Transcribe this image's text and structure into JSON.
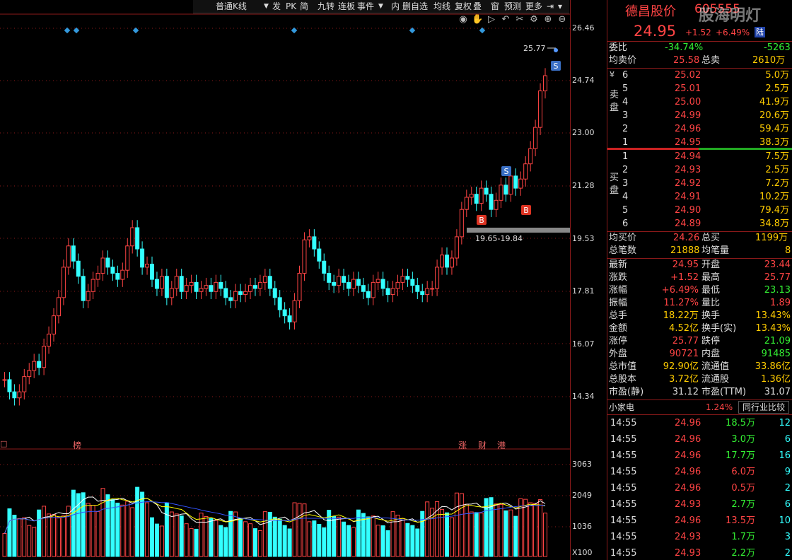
{
  "toolbar": {
    "items": [
      "普通K线",
      "发",
      "PK",
      "简",
      "九转",
      "连板",
      "事件",
      "内",
      "删自选",
      "均线",
      "复权",
      "叠",
      "窗",
      "预测",
      "更多"
    ],
    "dropdown_arrow": "▼",
    "pin_icon": "pin-icon"
  },
  "stock": {
    "name": "德昌股价",
    "code": "605555",
    "price": "24.95",
    "change": "+1.52",
    "change_pct": "+6.49%",
    "badge": "陆",
    "watermark": "股海明灯"
  },
  "chart": {
    "price_axis": [
      "26.46",
      "24.74",
      "23.00",
      "21.28",
      "19.53",
      "17.81",
      "16.07",
      "14.34"
    ],
    "vol_axis": [
      "3063",
      "2049",
      "1036",
      "X100"
    ],
    "high_marker": "25.77",
    "range_label": "19.65-19.84",
    "markers": [
      "S",
      "S",
      "B",
      "B"
    ],
    "event_tags": [
      "榜",
      "涨",
      "财",
      "港",
      "□"
    ],
    "colors": {
      "up": "#ff4444",
      "down": "#33ffff",
      "ma5": "#ffffff",
      "ma10": "#ffff00",
      "ma20": "#3355ff",
      "grid": "#8b1a1a"
    }
  },
  "quote": {
    "ratio_label": "委比",
    "ratio_pct": "-34.74%",
    "ratio_diff": "-5263",
    "avg_sell_label": "均卖价",
    "avg_sell": "25.58",
    "total_sell_label": "总卖",
    "total_sell": "2610万",
    "sell_side": "卖盘",
    "sell_marker": "¥",
    "sells": [
      {
        "lvl": "6",
        "price": "25.02",
        "vol": "5.0万"
      },
      {
        "lvl": "5",
        "price": "25.01",
        "vol": "2.5万"
      },
      {
        "lvl": "4",
        "price": "25.00",
        "vol": "41.9万"
      },
      {
        "lvl": "3",
        "price": "24.99",
        "vol": "20.6万"
      },
      {
        "lvl": "2",
        "price": "24.96",
        "vol": "59.4万"
      },
      {
        "lvl": "1",
        "price": "24.95",
        "vol": "38.3万"
      }
    ],
    "buy_side": "买盘",
    "buys": [
      {
        "lvl": "1",
        "price": "24.94",
        "vol": "7.5万"
      },
      {
        "lvl": "2",
        "price": "24.93",
        "vol": "2.5万"
      },
      {
        "lvl": "3",
        "price": "24.92",
        "vol": "7.2万"
      },
      {
        "lvl": "4",
        "price": "24.91",
        "vol": "10.2万"
      },
      {
        "lvl": "5",
        "price": "24.90",
        "vol": "79.4万"
      },
      {
        "lvl": "6",
        "price": "24.89",
        "vol": "34.8万"
      }
    ],
    "avg_buy_label": "均买价",
    "avg_buy": "24.26",
    "total_buy_label": "总买",
    "total_buy": "1199万",
    "total_trades_label": "总笔数",
    "total_trades": "21888",
    "avg_trade_label": "均笔量",
    "avg_trade": "8"
  },
  "stats": [
    {
      "l1": "最新",
      "v1": "24.95",
      "c1": "red",
      "l2": "开盘",
      "v2": "23.44",
      "c2": "red"
    },
    {
      "l1": "涨跌",
      "v1": "+1.52",
      "c1": "red",
      "l2": "最高",
      "v2": "25.77",
      "c2": "red"
    },
    {
      "l1": "涨幅",
      "v1": "+6.49%",
      "c1": "red",
      "l2": "最低",
      "v2": "23.13",
      "c2": "green"
    },
    {
      "l1": "振幅",
      "v1": "11.27%",
      "c1": "red",
      "l2": "量比",
      "v2": "1.89",
      "c2": "red"
    },
    {
      "l1": "总手",
      "v1": "18.22万",
      "c1": "yellow",
      "l2": "换手",
      "v2": "13.43%",
      "c2": "yellow"
    },
    {
      "l1": "金额",
      "v1": "4.52亿",
      "c1": "yellow",
      "l2": "换手(实)",
      "v2": "13.43%",
      "c2": "yellow"
    },
    {
      "l1": "涨停",
      "v1": "25.77",
      "c1": "red",
      "l2": "跌停",
      "v2": "21.09",
      "c2": "green"
    },
    {
      "l1": "外盘",
      "v1": "90721",
      "c1": "red",
      "l2": "内盘",
      "v2": "91485",
      "c2": "green"
    },
    {
      "l1": "总市值",
      "v1": "92.90亿",
      "c1": "yellow",
      "l2": "流通值",
      "v2": "33.86亿",
      "c2": "yellow"
    },
    {
      "l1": "总股本",
      "v1": "3.72亿",
      "c1": "yellow",
      "l2": "流通股",
      "v2": "1.36亿",
      "c2": "yellow"
    },
    {
      "l1": "市盈(静)",
      "v1": "31.12",
      "c1": "white",
      "l2": "市盈(TTM)",
      "v2": "31.07",
      "c2": "white"
    }
  ],
  "small_trades": {
    "label": "小家电",
    "pct": "1.24%",
    "compare": "同行业比较"
  },
  "ticks": [
    {
      "t": "14:55",
      "p": "24.96",
      "v": "18.5万",
      "n": "12",
      "vc": "green"
    },
    {
      "t": "14:55",
      "p": "24.96",
      "v": "3.0万",
      "n": "6",
      "vc": "green"
    },
    {
      "t": "14:55",
      "p": "24.96",
      "v": "17.7万",
      "n": "16",
      "vc": "green"
    },
    {
      "t": "14:55",
      "p": "24.96",
      "v": "6.0万",
      "n": "9",
      "vc": "red"
    },
    {
      "t": "14:55",
      "p": "24.96",
      "v": "0.5万",
      "n": "2",
      "vc": "red"
    },
    {
      "t": "14:55",
      "p": "24.93",
      "v": "2.7万",
      "n": "6",
      "vc": "green"
    },
    {
      "t": "14:55",
      "p": "24.96",
      "v": "13.5万",
      "n": "10",
      "vc": "red"
    },
    {
      "t": "14:55",
      "p": "24.93",
      "v": "1.7万",
      "n": "3",
      "vc": "green"
    },
    {
      "t": "14:55",
      "p": "24.93",
      "v": "2.2万",
      "n": "2",
      "vc": "green"
    }
  ]
}
